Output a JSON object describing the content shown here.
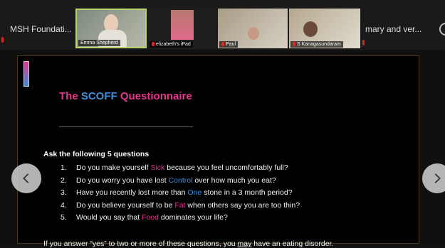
{
  "participants": {
    "host_label": "MSH Foundati...",
    "tiles": [
      {
        "name": "Emma Shepherd"
      },
      {
        "name": "elizabeth's iPad"
      },
      {
        "name": "Paul"
      },
      {
        "name": "S Kanagasundaram"
      }
    ],
    "overflow_label": "mary   and ver..."
  },
  "slide": {
    "title_prefix": "The ",
    "title_highlight": "SCOFF",
    "title_suffix": " Questionnaire",
    "intro": "Ask the following 5 questions",
    "questions": [
      {
        "num": "1.",
        "pre": "Do you make yourself ",
        "kw": "Sick",
        "post": " because you feel uncomfortably full?"
      },
      {
        "num": "2.",
        "pre": "Do you worry you have lost ",
        "kw": "Control",
        "post": " over how much you eat?"
      },
      {
        "num": "3.",
        "pre": "Have you recently lost more than ",
        "kw": "One",
        "post": " stone in a 3 month period?"
      },
      {
        "num": "4.",
        "pre": "Do you believe yourself to be ",
        "kw": "Fat",
        "post": " when others say you are too thin?"
      },
      {
        "num": "5.",
        "pre": "Would you say that ",
        "kw": "Food",
        "post": " dominates your life?"
      }
    ],
    "outro_pre": "If you answer “yes” to two or more of these questions, you ",
    "outro_underlined": "may",
    "outro_post": " have an eating disorder."
  },
  "nav": {
    "prev_icon": "chevron-left-icon",
    "next_icon": "chevron-right-icon"
  },
  "colors": {
    "pink": "#e8348f",
    "blue": "#3d8fde"
  }
}
